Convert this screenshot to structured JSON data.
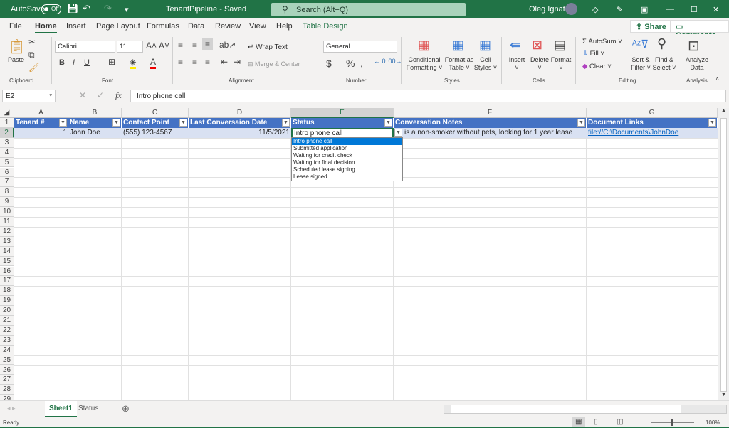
{
  "titlebar": {
    "autosave": "AutoSave",
    "autosave_state": "Off",
    "doc_title": "TenantPipeline  -  Saved",
    "search_placeholder": "Search (Alt+Q)",
    "user": "Oleg Ignat"
  },
  "menu": {
    "tabs": [
      "File",
      "Home",
      "Insert",
      "Page Layout",
      "Formulas",
      "Data",
      "Review",
      "View",
      "Help",
      "Table Design"
    ],
    "active": "Home",
    "share": "Share",
    "comments": "Comments"
  },
  "ribbon": {
    "clipboard": {
      "paste": "Paste",
      "label": "Clipboard"
    },
    "font": {
      "name": "Calibri",
      "size": "11",
      "label": "Font"
    },
    "alignment": {
      "wrap": "Wrap Text",
      "merge": "Merge & Center",
      "label": "Alignment"
    },
    "number": {
      "format": "General",
      "label": "Number"
    },
    "styles": {
      "conditional": "Conditional",
      "formatting": "Formatting",
      "format_as": "Format as",
      "table": "Table",
      "cell": "Cell",
      "cell_styles": "Styles",
      "label": "Styles"
    },
    "cells": {
      "insert": "Insert",
      "delete": "Delete",
      "format": "Format",
      "label": "Cells"
    },
    "editing": {
      "autosum": "AutoSum",
      "fill": "Fill",
      "clear": "Clear",
      "sort": "Sort &",
      "filter": "Filter",
      "find": "Find &",
      "select": "Select",
      "label": "Editing"
    },
    "analysis": {
      "analyze": "Analyze",
      "data": "Data",
      "label": "Analysis"
    }
  },
  "formula_bar": {
    "name_box": "E2",
    "fx": "fx",
    "value": "Intro phone call"
  },
  "sheet": {
    "columns": [
      "A",
      "B",
      "C",
      "D",
      "E",
      "F",
      "G"
    ],
    "selected_column": "E",
    "headers": [
      "Tenant #",
      "Name",
      "Contact Point",
      "Last Conversaion Date",
      "Status",
      "Conversation Notes",
      "Document Links"
    ],
    "row2": [
      "1",
      "John Doe",
      "(555) 123-4567",
      "11/5/2021",
      "Intro phone call",
      "is a non-smoker without pets, looking for 1 year lease",
      "file://C:\\Documents\\JohnDoe"
    ],
    "row_numbers": [
      "1",
      "2",
      "3",
      "4",
      "5",
      "6",
      "7",
      "8",
      "9",
      "10",
      "11",
      "12",
      "13",
      "14",
      "15",
      "16",
      "17",
      "18",
      "19",
      "20",
      "21",
      "22",
      "23",
      "24",
      "25",
      "26",
      "27",
      "28",
      "29"
    ],
    "dropdown_options": [
      "Intro phone call",
      "Submitted application",
      "Waiting for credit check",
      "Waiting for final decision",
      "Scheduled lease signing",
      "Lease signed"
    ],
    "table_color": "#4472c4"
  },
  "sheet_tabs": {
    "tabs": [
      "Sheet1",
      "Status"
    ],
    "active": "Sheet1"
  },
  "status": {
    "ready": "Ready",
    "zoom": "100%"
  }
}
